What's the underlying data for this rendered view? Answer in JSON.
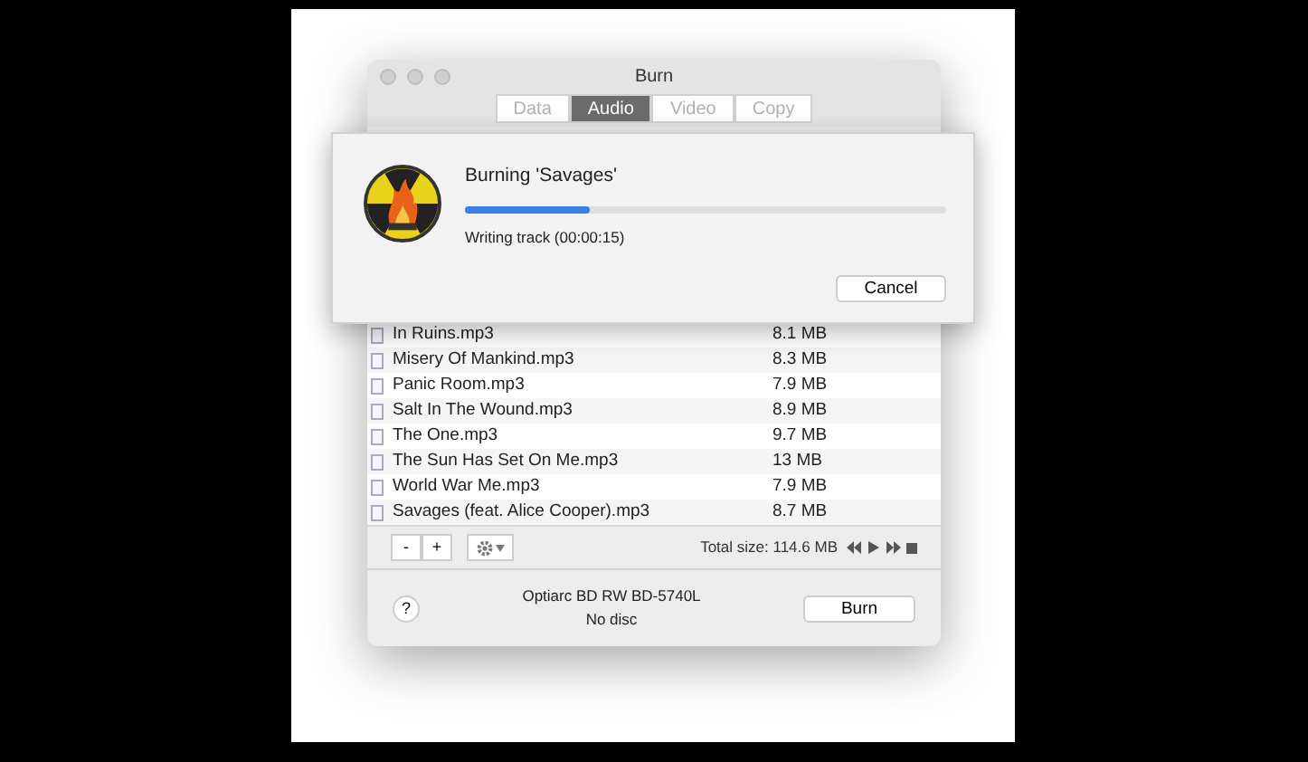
{
  "window": {
    "title": "Burn"
  },
  "tabs": [
    {
      "label": "Data",
      "selected": false
    },
    {
      "label": "Audio",
      "selected": true
    },
    {
      "label": "Video",
      "selected": false
    },
    {
      "label": "Copy",
      "selected": false
    }
  ],
  "sheet": {
    "title": "Burning 'Savages'",
    "level": 0.26,
    "status": "Writing track (00:00:15)",
    "cancel": "Cancel"
  },
  "files": [
    {
      "name": "In Ruins.mp3",
      "size": "8.1 MB"
    },
    {
      "name": "Misery Of Mankind.mp3",
      "size": "8.3 MB"
    },
    {
      "name": "Panic Room.mp3",
      "size": "7.9 MB"
    },
    {
      "name": "Salt In The Wound.mp3",
      "size": "8.9 MB"
    },
    {
      "name": "The One.mp3",
      "size": "9.7 MB"
    },
    {
      "name": "The Sun Has Set On Me.mp3",
      "size": "13 MB"
    },
    {
      "name": "World War Me.mp3",
      "size": "7.9 MB"
    },
    {
      "name": "Savages (feat. Alice Cooper).mp3",
      "size": "8.7 MB"
    }
  ],
  "toolbar": {
    "remove": "-",
    "add": "+",
    "total": "Total size: 114.6 MB"
  },
  "footer": {
    "help": "?",
    "drive": "Optiarc BD RW BD-5740L",
    "disc": "No disc",
    "burn": "Burn"
  }
}
